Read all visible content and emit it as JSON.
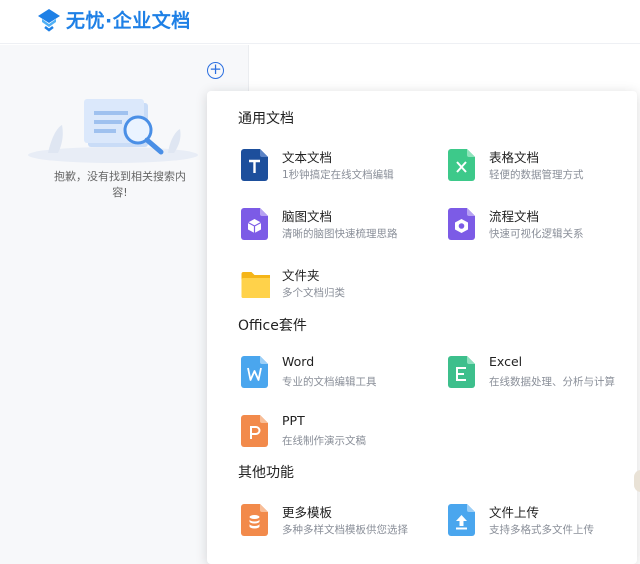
{
  "app": {
    "logo_text": "无忧·企业文档",
    "brand_color": "#1e80e6"
  },
  "sidebar": {
    "add_icon": "plus-circle-icon",
    "empty_message": "抱歉，没有找到相关搜索内容!"
  },
  "panel": {
    "sections": [
      {
        "title": "通用文档",
        "items": [
          {
            "name": "文本文档",
            "desc": "1秒钟搞定在线文档编辑",
            "icon": "text-doc-icon",
            "color": "#1d4f9c"
          },
          {
            "name": "表格文档",
            "desc": "轻便的数据管理方式",
            "icon": "sheet-doc-icon",
            "color": "#3dc98a"
          },
          {
            "name": "脑图文档",
            "desc": "清晰的脑图快速梳理思路",
            "icon": "mindmap-doc-icon",
            "color": "#7c5be6"
          },
          {
            "name": "流程文档",
            "desc": "快速可视化逻辑关系",
            "icon": "flow-doc-icon",
            "color": "#7c5be6"
          },
          {
            "name": "文件夹",
            "desc": "多个文档归类",
            "icon": "folder-icon",
            "color": "#ffc62b"
          }
        ]
      },
      {
        "title": "Office套件",
        "items": [
          {
            "name": "Word",
            "desc": "专业的文档编辑工具",
            "icon": "word-doc-icon",
            "color": "#4aa6ee"
          },
          {
            "name": "Excel",
            "desc": "在线数据处理、分析与计算",
            "icon": "excel-doc-icon",
            "color": "#3dbf8c"
          },
          {
            "name": "PPT",
            "desc": "在线制作演示文稿",
            "icon": "ppt-doc-icon",
            "color": "#f28a4b"
          }
        ]
      },
      {
        "title": "其他功能",
        "items": [
          {
            "name": "更多模板",
            "desc": "多种多样文档模板供您选择",
            "icon": "template-icon",
            "color": "#f28a4b"
          },
          {
            "name": "文件上传",
            "desc": "支持多格式多文件上传",
            "icon": "upload-icon",
            "color": "#4aa6ee"
          }
        ]
      }
    ]
  }
}
